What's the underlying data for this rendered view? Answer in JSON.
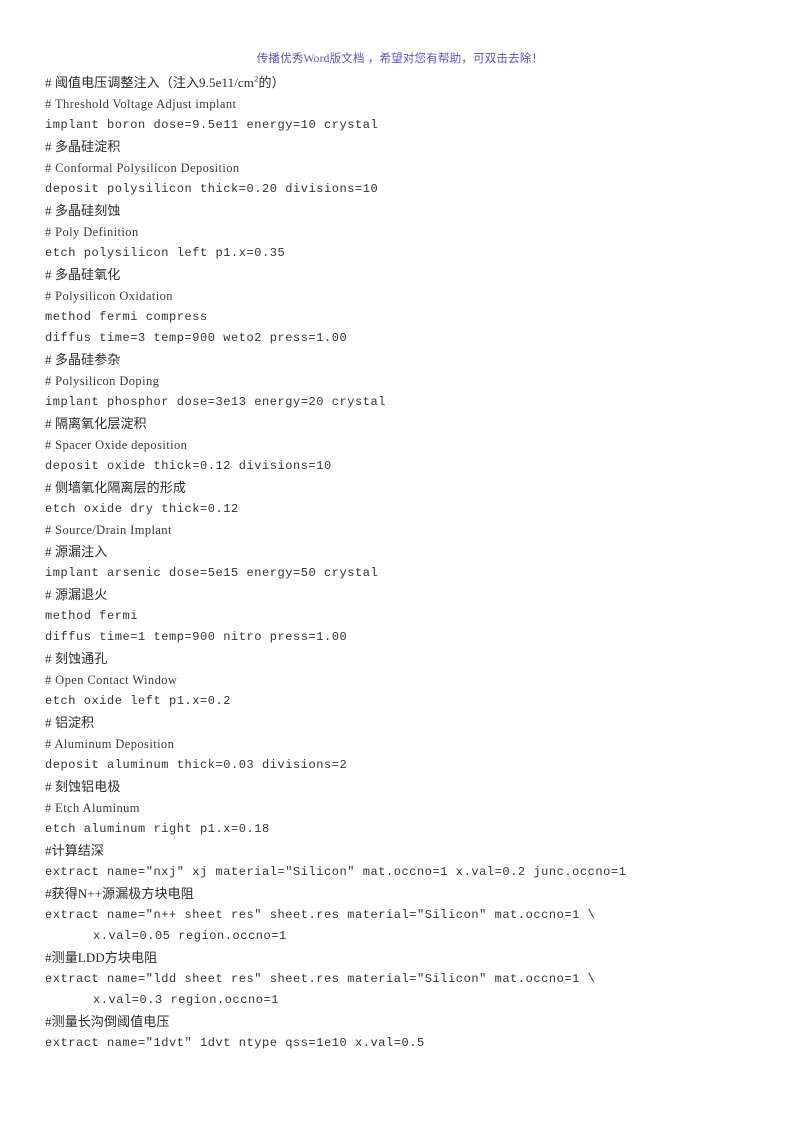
{
  "header": {
    "banner_text": "传播优秀Word版文档 ，希望对您有帮助，可双击去除！",
    "banner_color": "#5b55b5"
  },
  "document": {
    "text_color": "#2b2b2b",
    "background_color": "#ffffff",
    "lines": [
      {
        "kind": "cn",
        "text": "# 阈值电压调整注入（注入9.5e11/cm",
        "sup": "2",
        "text_after": "的）"
      },
      {
        "kind": "en",
        "text": "# Threshold Voltage Adjust implant"
      },
      {
        "kind": "cmd",
        "text": "implant boron dose=9.5e11 energy=10 crystal"
      },
      {
        "kind": "cn",
        "text": "# 多晶硅淀积"
      },
      {
        "kind": "en",
        "text": "# Conformal Polysilicon Deposition"
      },
      {
        "kind": "cmd",
        "text": "deposit polysilicon thick=0.20 divisions=10"
      },
      {
        "kind": "cn",
        "text": "# 多晶硅刻蚀"
      },
      {
        "kind": "en",
        "text": "# Poly Definition"
      },
      {
        "kind": "cmd",
        "text": "etch polysilicon left p1.x=0.35"
      },
      {
        "kind": "cn",
        "text": "# 多晶硅氧化"
      },
      {
        "kind": "en",
        "text": "# Polysilicon Oxidation"
      },
      {
        "kind": "cmd",
        "text": "method fermi compress"
      },
      {
        "kind": "cmd",
        "text": "diffus time=3 temp=900 weto2 press=1.00"
      },
      {
        "kind": "cn",
        "text": "# 多晶硅参杂"
      },
      {
        "kind": "en",
        "text": "# Polysilicon Doping"
      },
      {
        "kind": "cmd",
        "text": "implant phosphor dose=3e13 energy=20 crystal"
      },
      {
        "kind": "cn",
        "text": "# 隔离氧化层淀积"
      },
      {
        "kind": "en",
        "text": "# Spacer Oxide deposition"
      },
      {
        "kind": "cmd",
        "text": "deposit oxide thick=0.12 divisions=10"
      },
      {
        "kind": "cn",
        "text": "# 侧墙氧化隔离层的形成"
      },
      {
        "kind": "cmd",
        "text": "etch oxide dry thick=0.12"
      },
      {
        "kind": "en",
        "text": "# Source/Drain Implant"
      },
      {
        "kind": "cn",
        "text": "# 源漏注入"
      },
      {
        "kind": "cmd",
        "text": "implant arsenic dose=5e15 energy=50 crystal"
      },
      {
        "kind": "cn",
        "text": "# 源漏退火"
      },
      {
        "kind": "cmd",
        "text": "method fermi"
      },
      {
        "kind": "cmd",
        "text": "diffus time=1 temp=900 nitro press=1.00"
      },
      {
        "kind": "cn",
        "text": "# 刻蚀通孔"
      },
      {
        "kind": "en",
        "text": "# Open Contact Window"
      },
      {
        "kind": "cmd",
        "text": "etch oxide left p1.x=0.2"
      },
      {
        "kind": "cn",
        "text": "# 铝淀积"
      },
      {
        "kind": "en",
        "text": "# Aluminum Deposition"
      },
      {
        "kind": "cmd",
        "text": "deposit aluminum thick=0.03 divisions=2"
      },
      {
        "kind": "cn",
        "text": "# 刻蚀铝电极"
      },
      {
        "kind": "en",
        "text": "# Etch Aluminum"
      },
      {
        "kind": "cmd",
        "text": "etch aluminum right p1.x=0.18"
      },
      {
        "kind": "cn",
        "text": "#计算结深"
      },
      {
        "kind": "cmd",
        "text": "extract name=\"nxj\" xj material=\"Silicon\" mat.occno=1 x.val=0.2 junc.occno=1"
      },
      {
        "kind": "cn",
        "text": "#获得N++源漏极方块电阻"
      },
      {
        "kind": "cmd",
        "text": "extract name=\"n++ sheet res\" sheet.res material=\"Silicon\" mat.occno=1 \\"
      },
      {
        "kind": "cmd-cont",
        "text": "x.val=0.05 region.occno=1"
      },
      {
        "kind": "cn",
        "text": "#测量LDD方块电阻"
      },
      {
        "kind": "cmd",
        "text": "extract name=\"ldd sheet res\" sheet.res material=\"Silicon\" mat.occno=1 \\"
      },
      {
        "kind": "cmd-cont",
        "text": "x.val=0.3 region.occno=1"
      },
      {
        "kind": "cn",
        "text": "#测量长沟倒阈值电压"
      },
      {
        "kind": "cmd",
        "text": "extract name=\"1dvt\" 1dvt ntype qss=1e10 x.val=0.5"
      }
    ]
  }
}
